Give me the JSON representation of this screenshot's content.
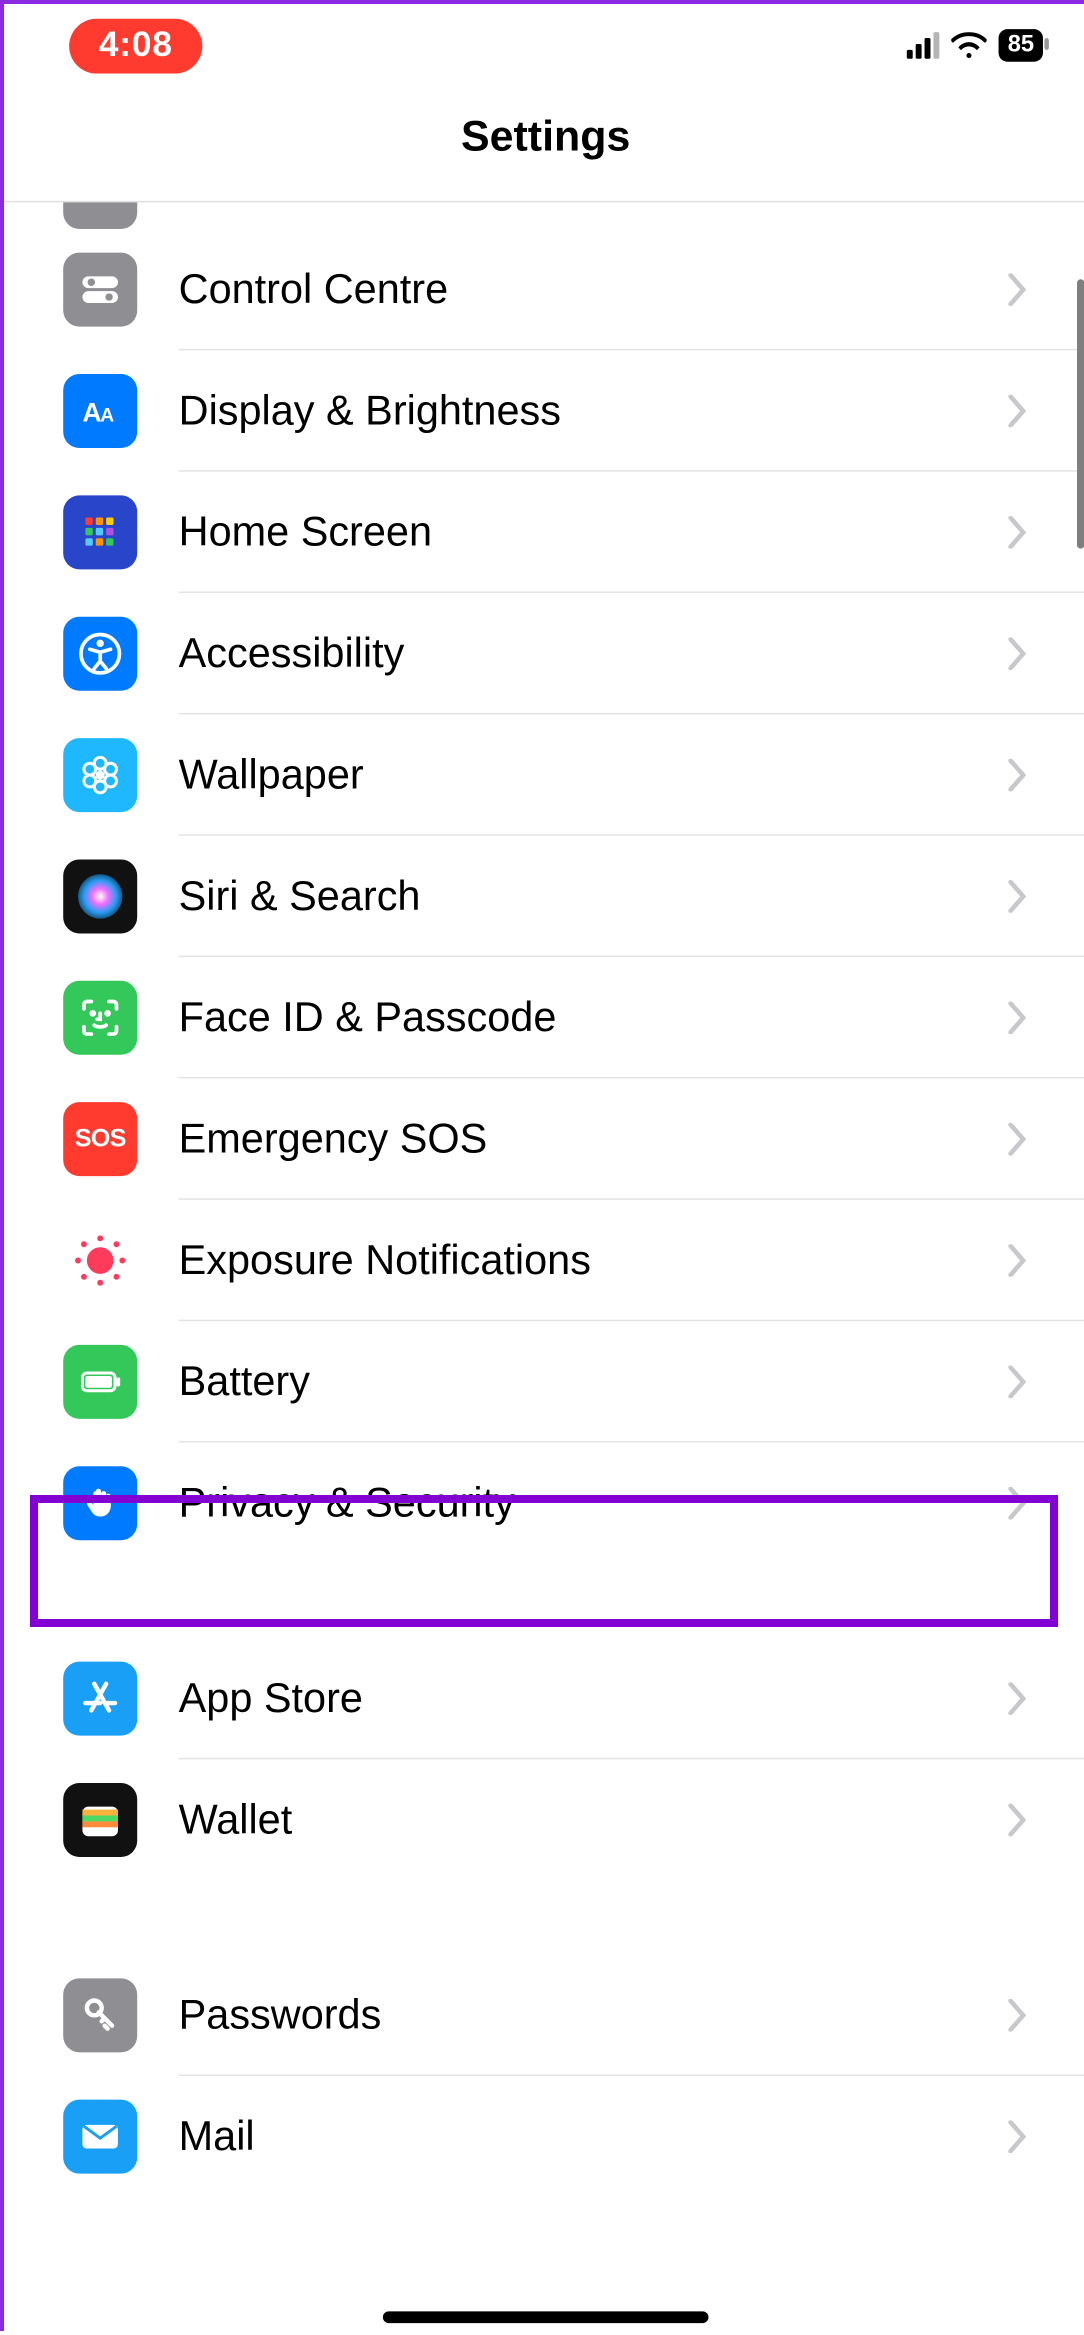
{
  "statusbar": {
    "time": "4:08",
    "battery": "85"
  },
  "header": {
    "title": "Settings"
  },
  "groups": [
    {
      "items": [
        {
          "key": "partial",
          "label": ""
        },
        {
          "key": "control",
          "label": "Control Centre"
        },
        {
          "key": "display",
          "label": "Display & Brightness"
        },
        {
          "key": "home",
          "label": "Home Screen"
        },
        {
          "key": "access",
          "label": "Accessibility"
        },
        {
          "key": "wall",
          "label": "Wallpaper"
        },
        {
          "key": "siri",
          "label": "Siri & Search"
        },
        {
          "key": "faceid",
          "label": "Face ID & Passcode"
        },
        {
          "key": "sos",
          "label": "Emergency SOS"
        },
        {
          "key": "exposure",
          "label": "Exposure Notifications"
        },
        {
          "key": "battery",
          "label": "Battery"
        },
        {
          "key": "privacy",
          "label": "Privacy & Security"
        }
      ]
    },
    {
      "items": [
        {
          "key": "appstore",
          "label": "App Store"
        },
        {
          "key": "wallet",
          "label": "Wallet"
        }
      ]
    },
    {
      "items": [
        {
          "key": "pass",
          "label": "Passwords"
        },
        {
          "key": "mail",
          "label": "Mail"
        }
      ]
    }
  ],
  "colors": {
    "gray": "#8e8e93",
    "blue": "#007aff",
    "cyan": "#1fb8ff",
    "green": "#34c759",
    "red": "#ff3b30",
    "black": "#000",
    "lime": "#32d74b",
    "lblue": "#0a84ff"
  },
  "highlight": {
    "row_key": "privacy"
  }
}
